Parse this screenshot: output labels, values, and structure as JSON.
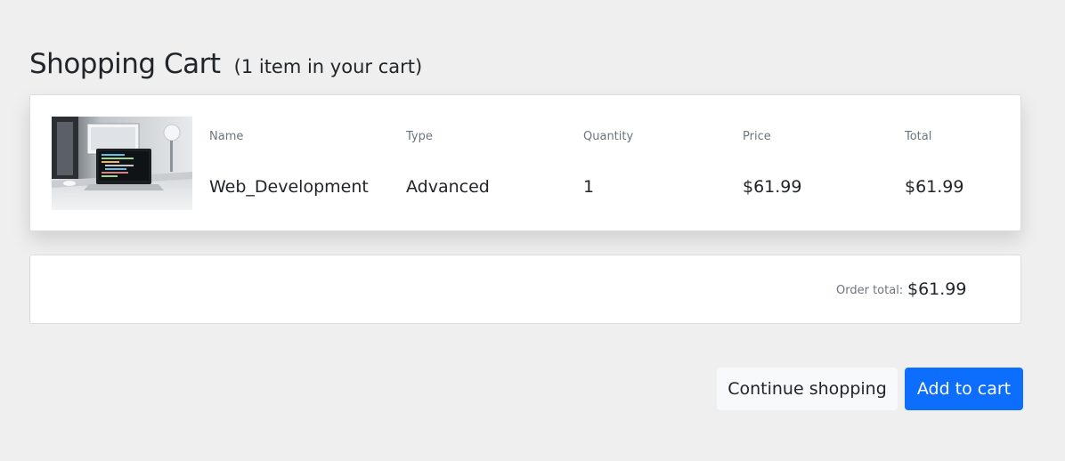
{
  "heading": {
    "title": "Shopping Cart",
    "subtitle": "(1 item in your cart)"
  },
  "cart": {
    "columns": {
      "name": "Name",
      "type": "Type",
      "quantity": "Quantity",
      "price": "Price",
      "total": "Total"
    },
    "item": {
      "image_icon": "laptop-desk-photo",
      "name": "Web_Development",
      "type": "Advanced",
      "quantity": "1",
      "price": "$61.99",
      "total": "$61.99"
    }
  },
  "summary": {
    "order_total_label": "Order total:",
    "order_total_value": "$61.99"
  },
  "actions": {
    "continue_label": "Continue shopping",
    "add_label": "Add to cart"
  },
  "colors": {
    "background": "#efefef",
    "primary": "#0d6efd",
    "light_button": "#f8f9fa",
    "muted_text": "#6c757d"
  }
}
